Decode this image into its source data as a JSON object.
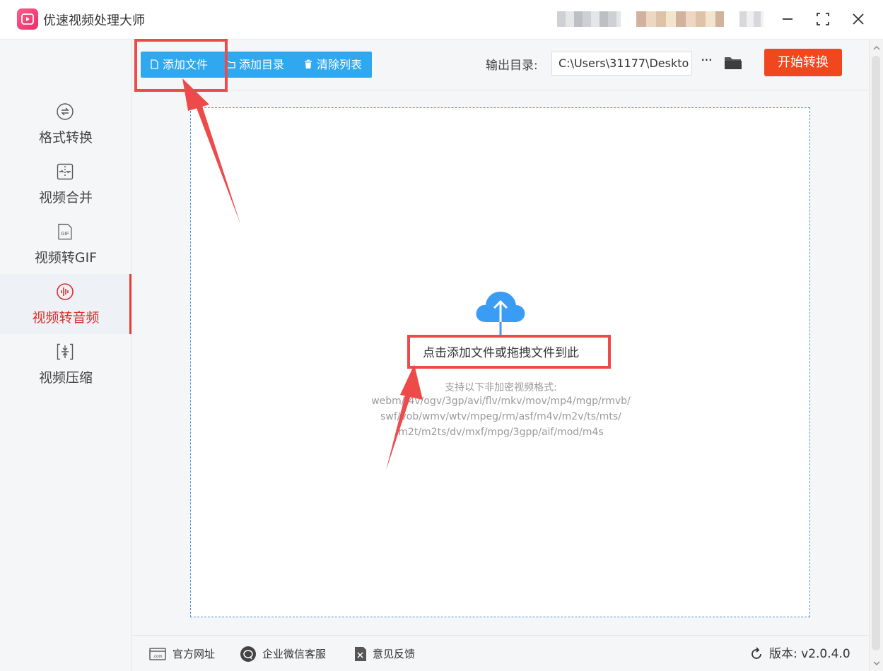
{
  "window": {
    "title": "优速视频处理大师"
  },
  "sidebar": {
    "items": [
      {
        "label": "格式转换",
        "icon": "format-convert-icon"
      },
      {
        "label": "视频合并",
        "icon": "merge-icon"
      },
      {
        "label": "视频转GIF",
        "icon": "gif-icon"
      },
      {
        "label": "视频转音频",
        "icon": "audio-wave-icon",
        "active": true
      },
      {
        "label": "视频压缩",
        "icon": "compress-icon"
      }
    ]
  },
  "toolbar": {
    "add_file": "添加文件",
    "add_dir": "添加目录",
    "clear_list": "清除列表",
    "output_label": "输出目录:",
    "output_path": "C:\\Users\\31177\\Deskto",
    "more": "···",
    "start": "开始转换"
  },
  "dropzone": {
    "title": "点击添加文件或拖拽文件到此",
    "supported_label": "支持以下非加密视频格式:",
    "formats_line1": "webm/f4v/ogv/3gp/avi/flv/mkv/mov/mp4/mgp/rmvb/",
    "formats_line2": "swf/vob/wmv/wtv/mpeg/rm/asf/m4v/m2v/ts/mts/",
    "formats_line3": "m2t/m2ts/dv/mxf/mpg/3gpp/aif/mod/m4s"
  },
  "footer": {
    "website": "官方网址",
    "wechat": "企业微信客服",
    "feedback": "意见反馈",
    "version": "版本: v2.0.4.0"
  },
  "colors": {
    "accent_blue": "#2fa8f0",
    "start_orange": "#f0471f",
    "active_red": "#d9302c",
    "annotation_red": "#ef4a4a",
    "cloud_blue": "#3b9cf5"
  }
}
